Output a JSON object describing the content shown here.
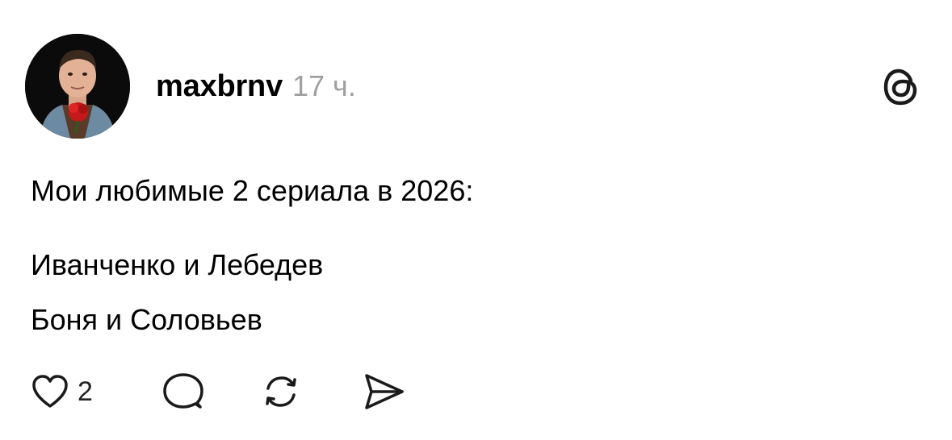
{
  "post": {
    "author": {
      "username": "maxbrnv",
      "timestamp": "17 ч."
    },
    "lines": [
      "Мои любимые 2 сериала в 2026:",
      "Иванченко и Лебедев",
      "Боня и Соловьев"
    ],
    "actions": {
      "like_icon": "heart-icon",
      "like_count": "2",
      "reply_icon": "speech-bubble-icon",
      "repost_icon": "repost-icon",
      "share_icon": "paper-plane-icon"
    },
    "brand_icon": "threads-logo"
  },
  "colors": {
    "text": "#000000",
    "muted": "#a0a0a0",
    "background": "#ffffff",
    "icon": "#1a1a1a"
  }
}
